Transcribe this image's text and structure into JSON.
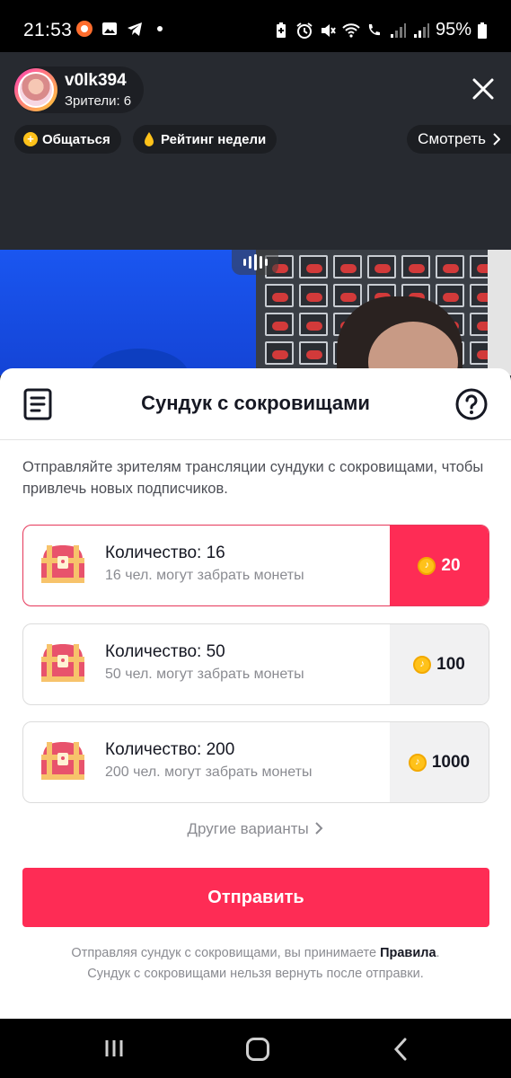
{
  "status_bar": {
    "time": "21:53",
    "battery": "95%",
    "left_icons": [
      "recorder-icon",
      "gallery-icon",
      "telegram-icon",
      "dot-icon"
    ],
    "right_icons": [
      "battery-saver-icon",
      "alarm-icon",
      "mute-icon",
      "wifi-icon",
      "call-icon",
      "signal-icon",
      "signal-icon",
      "battery-icon"
    ]
  },
  "live": {
    "host_name": "v0lk394",
    "viewers": "Зрители: 6",
    "chips": {
      "chat": "Общаться",
      "rating": "Рейтинг недели",
      "watch": "Смотреть"
    }
  },
  "sheet": {
    "title": "Сундук с сокровищами",
    "description": "Отправляйте зрителям трансляции сундуки с сокровищами, чтобы привлечь новых подписчиков.",
    "options": [
      {
        "quantity": "Количество: 16",
        "subtitle": "16 чел. могут забрать монеты",
        "price": "20",
        "selected": true
      },
      {
        "quantity": "Количество: 50",
        "subtitle": "50 чел. могут забрать монеты",
        "price": "100",
        "selected": false
      },
      {
        "quantity": "Количество: 200",
        "subtitle": "200 чел. могут забрать монеты",
        "price": "1000",
        "selected": false
      }
    ],
    "more_options": "Другие варианты",
    "send_button": "Отправить",
    "legal_line1_pre": "Отправляя сундук с сокровищами, вы принимаете",
    "legal_link": "Правила",
    "legal_line1_post": ".",
    "legal_line2": "Сундук с сокровищами нельзя вернуть после отправки."
  },
  "colors": {
    "accent": "#fe2c55",
    "coin": "#ffc21a",
    "text_primary": "#161823",
    "text_secondary": "#8a8b91"
  }
}
